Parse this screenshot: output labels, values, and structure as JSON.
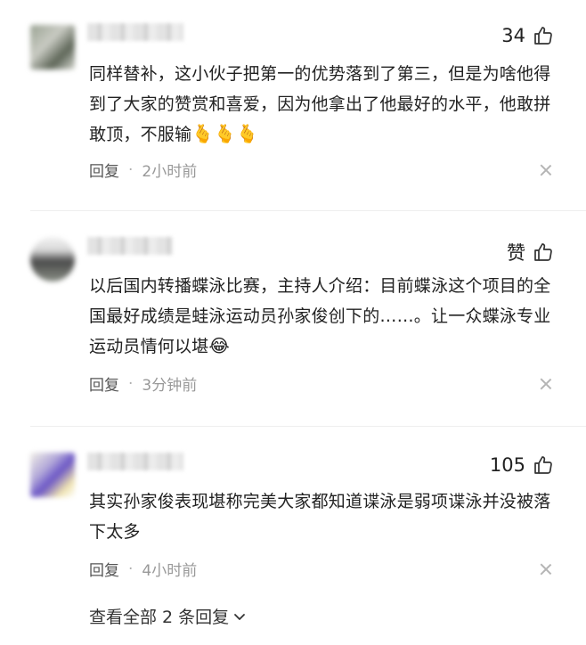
{
  "comments": [
    {
      "likes": "34",
      "text": "同样替补，这小伙子把第一的优势落到了第三，但是为啥他得到了大家的赞赏和喜爱，因为他拿出了他最好的水平，他敢拼敢顶，不服输",
      "emoji": "🫰🫰🫰",
      "reply_label": "回复",
      "time": "2小时前"
    },
    {
      "likes": "赞",
      "text": "以后国内转播蝶泳比赛，主持人介绍：目前蝶泳这个项目的全国最好成绩是蛙泳运动员孙家俊创下的……。让一众蝶泳专业运动员情何以堪",
      "emoji": "😂",
      "reply_label": "回复",
      "time": "3分钟前"
    },
    {
      "likes": "105",
      "text": "其实孙家俊表现堪称完美大家都知道谍泳是弱项谍泳并没被落下太多",
      "emoji": "",
      "reply_label": "回复",
      "time": "4小时前"
    }
  ],
  "view_all": "查看全部 2 条回复",
  "icons": {
    "like": "thumbs-up-icon",
    "close": "close-icon",
    "expand": "chevron-down-icon"
  }
}
